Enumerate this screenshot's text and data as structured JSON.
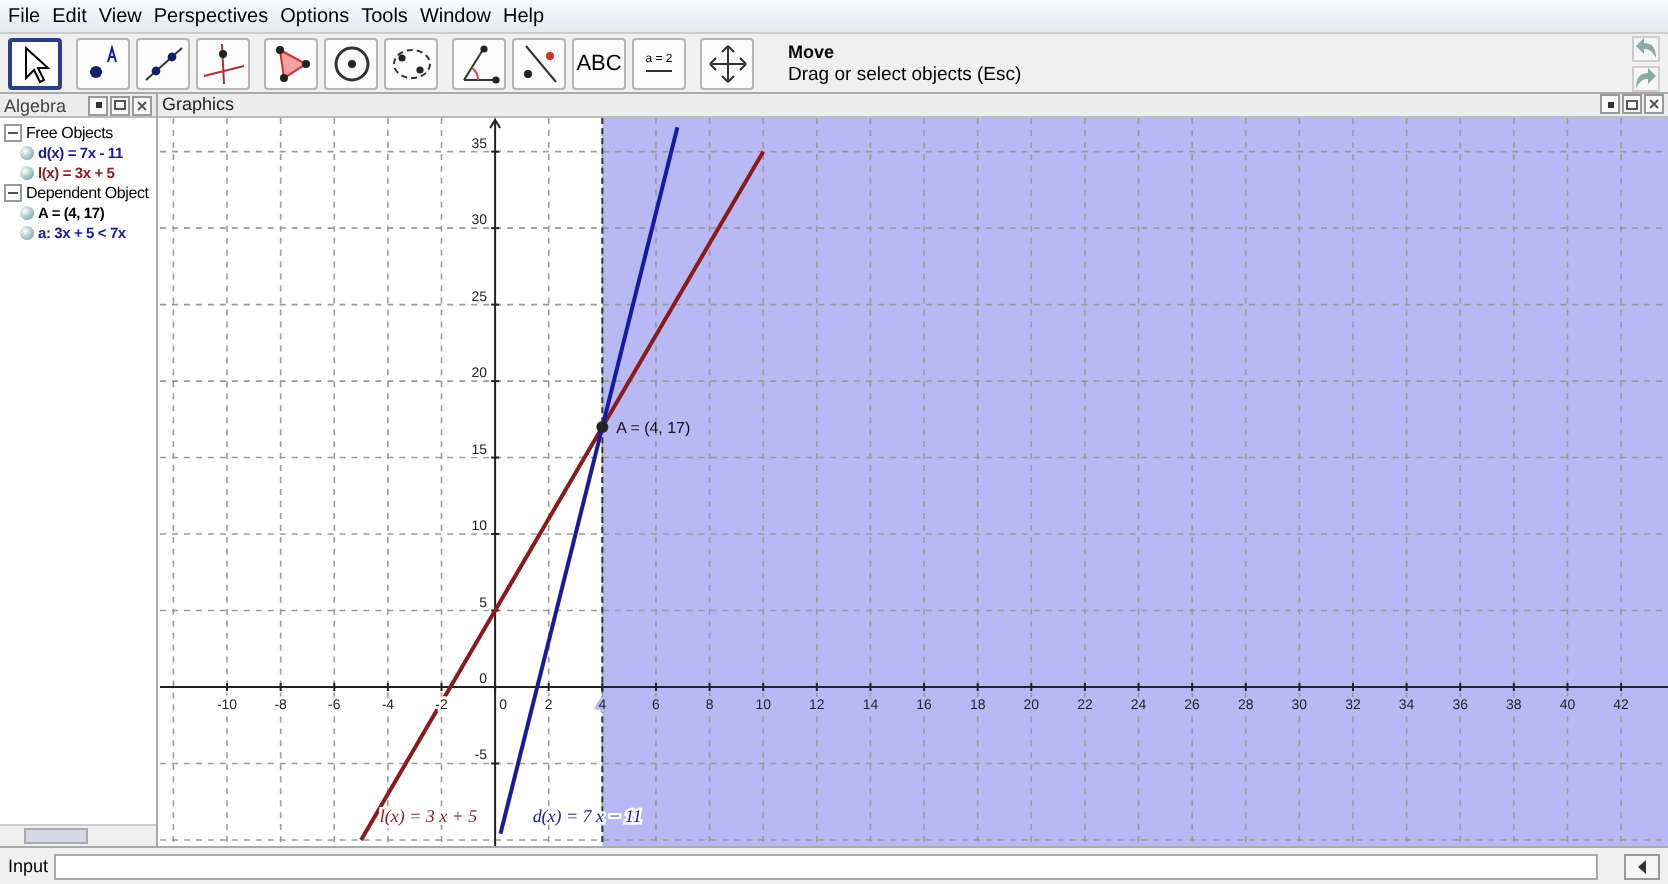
{
  "menu": [
    "File",
    "Edit",
    "View",
    "Perspectives",
    "Options",
    "Tools",
    "Window",
    "Help"
  ],
  "toolbar": {
    "tools": [
      {
        "kind": "move",
        "selected": true
      },
      {
        "kind": "point",
        "selected": false
      },
      {
        "kind": "line",
        "selected": false
      },
      {
        "kind": "perpendicular",
        "selected": false
      },
      {
        "kind": "polygon",
        "selected": false
      },
      {
        "kind": "circle",
        "selected": false
      },
      {
        "kind": "conic",
        "selected": false
      },
      {
        "kind": "angle",
        "selected": false
      },
      {
        "kind": "reflect",
        "selected": false
      },
      {
        "kind": "text",
        "label": "ABC",
        "selected": false
      },
      {
        "kind": "slider",
        "label": "a = 2",
        "selected": false
      },
      {
        "kind": "pan",
        "selected": false
      }
    ],
    "hint_title": "Move",
    "hint": "Drag or select objects (Esc)"
  },
  "algebra": {
    "title": "Algebra",
    "groups": [
      {
        "label": "Free Objects",
        "expanded": true,
        "children": [
          {
            "label": "d(x) = 7x - 11",
            "color": "#1a1a9a"
          },
          {
            "label": "l(x) = 3x + 5",
            "color": "#8b1a1a"
          }
        ]
      },
      {
        "label": "Dependent Object",
        "expanded": true,
        "children": [
          {
            "label": "A = (4, 17)",
            "color": "#000000"
          },
          {
            "label": "a: 3x + 5 < 7x",
            "color": "#1a1a9a"
          }
        ]
      }
    ]
  },
  "graphics": {
    "title": "Graphics",
    "chart_data": {
      "type": "line",
      "x": [
        -5,
        0.2,
        4,
        6.8,
        10
      ],
      "series": [
        {
          "name": "l(x) = 3 x + 5",
          "color": "#8b1a1a",
          "values": [
            -10,
            5.6,
            17,
            25.4,
            35
          ]
        },
        {
          "name": "d(x) = 7 x − 11",
          "color": "#1a1aa0",
          "values": [
            null,
            -9.6,
            17,
            36.6,
            null
          ]
        }
      ],
      "xlim": [
        -12.5,
        43.75
      ],
      "ylim": [
        -10.4,
        37.2
      ],
      "grid": true,
      "xticks": [
        -10,
        -8,
        -6,
        -4,
        -2,
        0,
        2,
        4,
        6,
        8,
        10,
        12,
        14,
        16,
        18,
        20,
        22,
        24,
        26,
        28,
        30,
        32,
        34,
        36,
        38,
        40,
        42
      ],
      "yticks": [
        -5,
        0,
        5,
        10,
        15,
        20,
        25,
        30,
        35
      ],
      "bands": [
        {
          "axis": "x",
          "from": 4,
          "to": 43.75,
          "color": "#b8b8f5"
        }
      ],
      "ref_lines": [
        {
          "axis": "x",
          "value": 4
        }
      ],
      "annotations": [
        {
          "text": "A = (4, 17)",
          "x": 4,
          "y": 17
        }
      ]
    }
  },
  "input": {
    "label": "Input"
  }
}
